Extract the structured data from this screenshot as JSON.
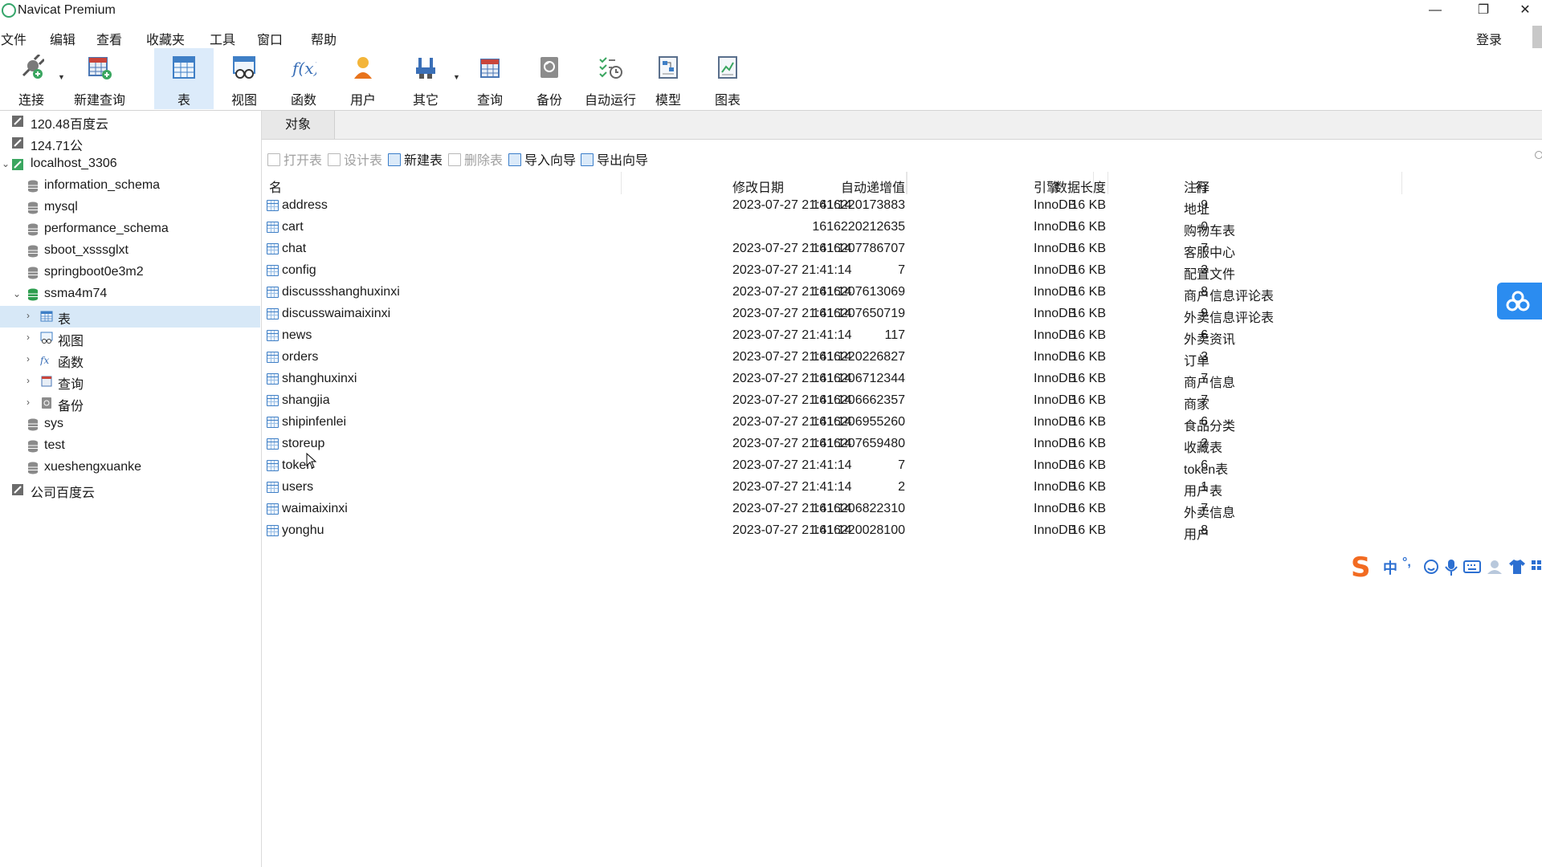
{
  "window": {
    "title": "Navicat Premium",
    "controls": {
      "minimize": "—",
      "restore": "❐",
      "close": "✕"
    }
  },
  "menu": {
    "items": [
      "文件",
      "编辑",
      "查看",
      "收藏夹",
      "工具",
      "窗口",
      "帮助"
    ],
    "login": "登录"
  },
  "toolbar": {
    "items": [
      {
        "label": "连接",
        "icon": "connect-icon"
      },
      {
        "label": "新建查询",
        "icon": "new-query-icon"
      },
      {
        "label": "表",
        "icon": "table-icon",
        "active": true
      },
      {
        "label": "视图",
        "icon": "view-icon"
      },
      {
        "label": "函数",
        "icon": "function-icon"
      },
      {
        "label": "用户",
        "icon": "user-icon"
      },
      {
        "label": "其它",
        "icon": "other-tools-icon"
      },
      {
        "label": "查询",
        "icon": "query-icon"
      },
      {
        "label": "备份",
        "icon": "backup-icon"
      },
      {
        "label": "自动运行",
        "icon": "auto-run-icon"
      },
      {
        "label": "模型",
        "icon": "model-icon"
      },
      {
        "label": "图表",
        "icon": "chart-icon"
      }
    ]
  },
  "sidebar": {
    "connections": [
      {
        "label": "120.48百度云",
        "icon": "connection-icon"
      },
      {
        "label": "124.71公",
        "icon": "connection-icon"
      },
      {
        "label": "localhost_3306",
        "icon": "mysql-connection-icon",
        "expanded": true
      }
    ],
    "databases": [
      "information_schema",
      "mysql",
      "performance_schema",
      "sboot_xsssglxt",
      "springboot0e3m2",
      "ssma4m74"
    ],
    "active_db_children": [
      {
        "label": "表",
        "icon": "table-icon",
        "selected": true
      },
      {
        "label": "视图",
        "icon": "view-icon"
      },
      {
        "label": "函数",
        "icon": "function-icon"
      },
      {
        "label": "查询",
        "icon": "query-icon"
      },
      {
        "label": "备份",
        "icon": "backup-icon"
      }
    ],
    "more_databases": [
      "sys",
      "test",
      "xueshengxuanke"
    ],
    "last_connection": "公司百度云"
  },
  "tabs": {
    "objects": "对象"
  },
  "object_toolbar": {
    "open": "打开表",
    "design": "设计表",
    "new": "新建表",
    "delete": "删除表",
    "import": "导入向导",
    "export": "导出向导"
  },
  "table": {
    "headers": {
      "name": "名",
      "auto_inc": "自动递增值",
      "modified": "修改日期",
      "data_length": "数据长度",
      "engine": "引擎",
      "rows": "行",
      "comment": "注释"
    },
    "rows": [
      {
        "name": "address",
        "auto_inc": "1616220173883",
        "modified": "2023-07-27 21:41:14",
        "size": "16 KB",
        "engine": "InnoDB",
        "rows": "9",
        "comment": "地址"
      },
      {
        "name": "cart",
        "auto_inc": "1616220212635",
        "modified": "",
        "size": "16 KB",
        "engine": "InnoDB",
        "rows": "0",
        "comment": "购物车表"
      },
      {
        "name": "chat",
        "auto_inc": "1616207786707",
        "modified": "2023-07-27 21:41:14",
        "size": "16 KB",
        "engine": "InnoDB",
        "rows": "7",
        "comment": "客服中心"
      },
      {
        "name": "config",
        "auto_inc": "7",
        "modified": "2023-07-27 21:41:14",
        "size": "16 KB",
        "engine": "InnoDB",
        "rows": "3",
        "comment": "配置文件"
      },
      {
        "name": "discussshanghuxinxi",
        "auto_inc": "1616207613069",
        "modified": "2023-07-27 21:41:14",
        "size": "16 KB",
        "engine": "InnoDB",
        "rows": "8",
        "comment": "商户信息评论表"
      },
      {
        "name": "discusswaimaixinxi",
        "auto_inc": "1616207650719",
        "modified": "2023-07-27 21:41:14",
        "size": "16 KB",
        "engine": "InnoDB",
        "rows": "9",
        "comment": "外卖信息评论表"
      },
      {
        "name": "news",
        "auto_inc": "117",
        "modified": "2023-07-27 21:41:14",
        "size": "16 KB",
        "engine": "InnoDB",
        "rows": "6",
        "comment": "外卖资讯"
      },
      {
        "name": "orders",
        "auto_inc": "1616220226827",
        "modified": "2023-07-27 21:41:14",
        "size": "16 KB",
        "engine": "InnoDB",
        "rows": "3",
        "comment": "订单"
      },
      {
        "name": "shanghuxinxi",
        "auto_inc": "1616206712344",
        "modified": "2023-07-27 21:41:14",
        "size": "16 KB",
        "engine": "InnoDB",
        "rows": "7",
        "comment": "商户信息"
      },
      {
        "name": "shangjia",
        "auto_inc": "1616206662357",
        "modified": "2023-07-27 21:41:14",
        "size": "16 KB",
        "engine": "InnoDB",
        "rows": "7",
        "comment": "商家"
      },
      {
        "name": "shipinfenlei",
        "auto_inc": "1616206955260",
        "modified": "2023-07-27 21:41:14",
        "size": "16 KB",
        "engine": "InnoDB",
        "rows": "6",
        "comment": "食品分类"
      },
      {
        "name": "storeup",
        "auto_inc": "1616207659480",
        "modified": "2023-07-27 21:41:14",
        "size": "16 KB",
        "engine": "InnoDB",
        "rows": "2",
        "comment": "收藏表"
      },
      {
        "name": "token",
        "auto_inc": "7",
        "modified": "2023-07-27 21:41:14",
        "size": "16 KB",
        "engine": "InnoDB",
        "rows": "6",
        "comment": "token表"
      },
      {
        "name": "users",
        "auto_inc": "2",
        "modified": "2023-07-27 21:41:14",
        "size": "16 KB",
        "engine": "InnoDB",
        "rows": "1",
        "comment": "用户表"
      },
      {
        "name": "waimaixinxi",
        "auto_inc": "1616206822310",
        "modified": "2023-07-27 21:41:14",
        "size": "16 KB",
        "engine": "InnoDB",
        "rows": "7",
        "comment": "外卖信息"
      },
      {
        "name": "yonghu",
        "auto_inc": "1616220028100",
        "modified": "2023-07-27 21:41:14",
        "size": "16 KB",
        "engine": "InnoDB",
        "rows": "8",
        "comment": "用户"
      }
    ]
  },
  "ime_bar": {
    "lang": "中",
    "punct": "°,"
  },
  "colors": {
    "accent": "#2b8cf0",
    "selection": "#d7e8f7",
    "toolbar_active": "#dcebfa",
    "sogou": "#f26b21"
  }
}
